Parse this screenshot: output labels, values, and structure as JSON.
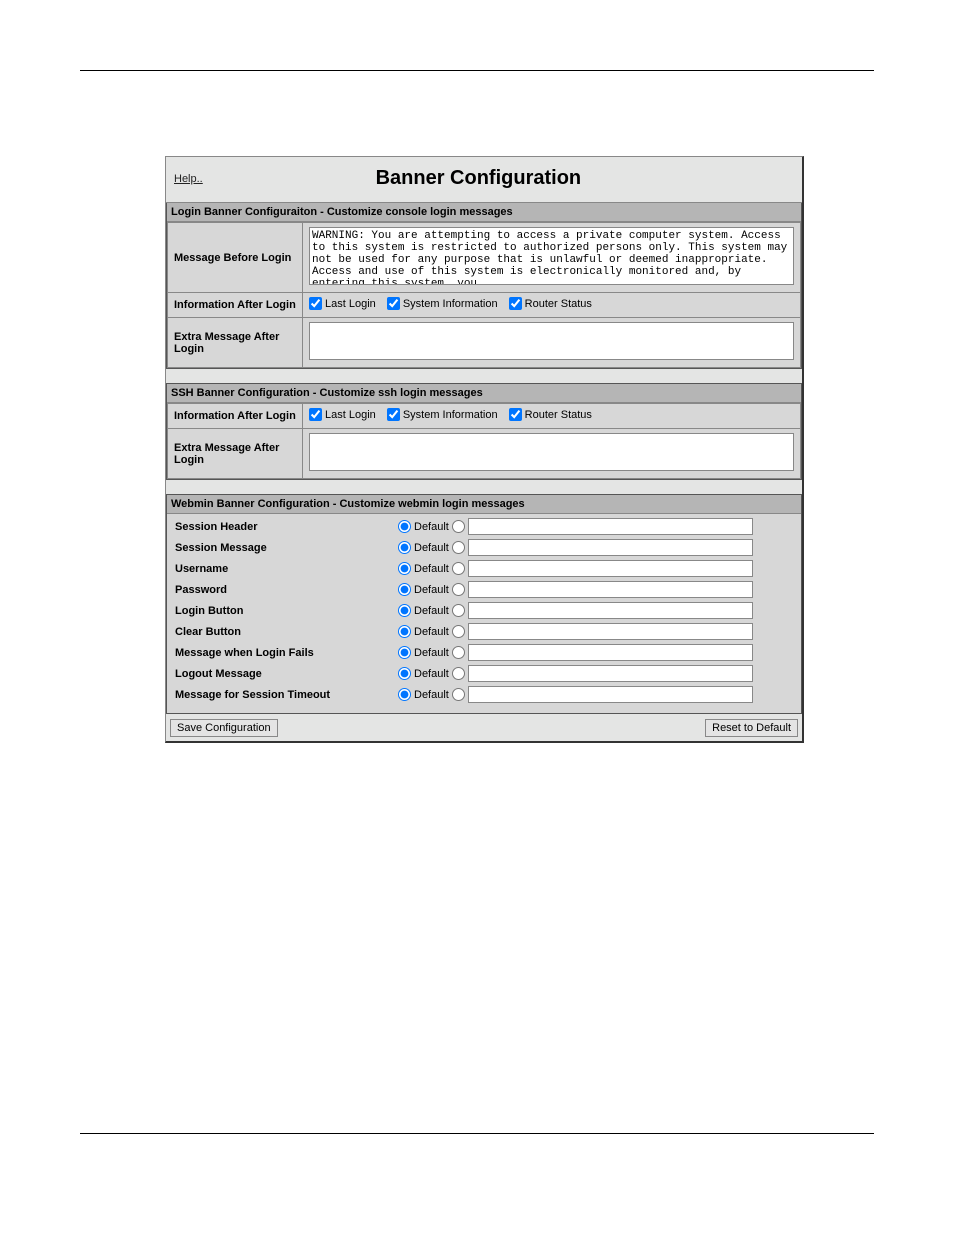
{
  "header": {
    "help": "Help..",
    "title": "Banner Configuration"
  },
  "login_section": {
    "heading": "Login Banner Configuraiton - Customize console login messages",
    "msg_before_label": "Message Before Login",
    "msg_before_value": "WARNING: You are attempting to access a private computer system. Access to this system is restricted to authorized persons only. This system may not be used for any purpose that is unlawful or deemed inappropriate.  Access and use of this system is electronically monitored and, by entering this system, you",
    "info_after_label": "Information After Login",
    "cb_last": "Last Login",
    "cb_sys": "System Information",
    "cb_router": "Router Status",
    "extra_after_label": "Extra Message After Login"
  },
  "ssh_section": {
    "heading": "SSH Banner Configuration - Customize ssh login messages",
    "info_after_label": "Information After Login",
    "cb_last": "Last Login",
    "cb_sys": "System Information",
    "cb_router": "Router Status",
    "extra_after_label": "Extra Message After Login"
  },
  "webmin_section": {
    "heading": "Webmin Banner Configuration - Customize webmin login messages",
    "default_label": "Default",
    "rows": [
      {
        "label": "Session Header"
      },
      {
        "label": "Session Message"
      },
      {
        "label": "Username"
      },
      {
        "label": "Password"
      },
      {
        "label": "Login Button"
      },
      {
        "label": "Clear Button"
      },
      {
        "label": "Message when Login Fails"
      },
      {
        "label": "Logout Message"
      },
      {
        "label": "Message for Session Timeout"
      }
    ]
  },
  "buttons": {
    "save": "Save Configuration",
    "reset": "Reset to Default"
  }
}
